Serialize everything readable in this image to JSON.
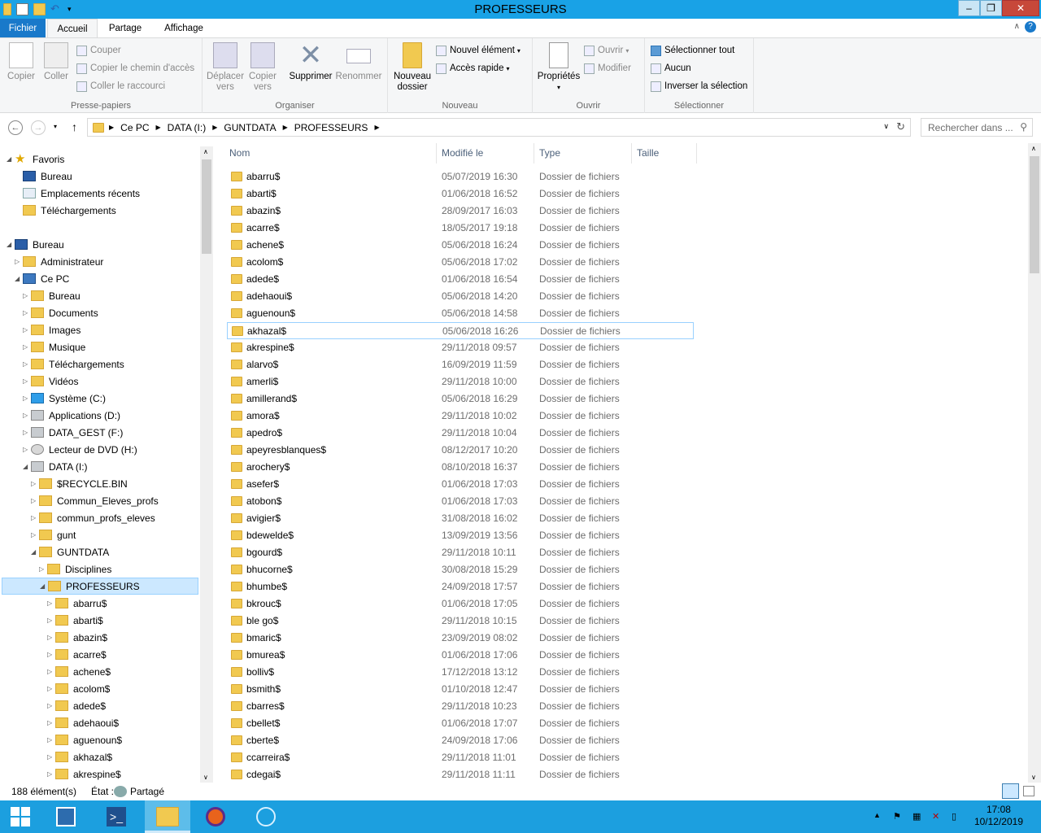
{
  "window": {
    "title": "PROFESSEURS"
  },
  "ribbon_tabs": {
    "file": "Fichier",
    "home": "Accueil",
    "share": "Partage",
    "view": "Affichage"
  },
  "ribbon": {
    "clipboard": {
      "label": "Presse-papiers",
      "copy": "Copier",
      "paste": "Coller",
      "cut": "Couper",
      "copy_path": "Copier le chemin d'accès",
      "paste_shortcut": "Coller le raccourci"
    },
    "organize": {
      "label": "Organiser",
      "move_l1": "Déplacer",
      "move_l2": "vers",
      "copyto_l1": "Copier",
      "copyto_l2": "vers",
      "delete": "Supprimer",
      "rename": "Renommer"
    },
    "new": {
      "label": "Nouveau",
      "new_folder_l1": "Nouveau",
      "new_folder_l2": "dossier",
      "new_item": "Nouvel élément",
      "easy_access": "Accès rapide"
    },
    "open": {
      "label": "Ouvrir",
      "properties": "Propriétés",
      "open": "Ouvrir",
      "edit": "Modifier"
    },
    "select": {
      "label": "Sélectionner",
      "select_all": "Sélectionner tout",
      "select_none": "Aucun",
      "invert": "Inverser la sélection"
    }
  },
  "address": {
    "crumbs": [
      "Ce PC",
      "DATA (I:)",
      "GUNTDATA",
      "PROFESSEURS"
    ],
    "search_placeholder": "Rechercher dans ..."
  },
  "tree": [
    {
      "label": "Favoris",
      "icon": "star-icon"
    },
    {
      "label": "Bureau",
      "icon": "desktop-icon"
    },
    {
      "label": "Emplacements récents",
      "icon": "recent-icon"
    },
    {
      "label": "Téléchargements",
      "icon": "downloads-icon"
    },
    {
      "label": "Bureau",
      "icon": "desktop-icon"
    },
    {
      "label": "Administrateur",
      "icon": "user-folder-icon"
    },
    {
      "label": "Ce PC",
      "icon": "computer-icon"
    },
    {
      "label": "Bureau",
      "icon": "folder-icon"
    },
    {
      "label": "Documents",
      "icon": "folder-icon"
    },
    {
      "label": "Images",
      "icon": "folder-icon"
    },
    {
      "label": "Musique",
      "icon": "folder-icon"
    },
    {
      "label": "Téléchargements",
      "icon": "folder-icon"
    },
    {
      "label": "Vidéos",
      "icon": "folder-icon"
    },
    {
      "label": "Système (C:)",
      "icon": "windows-drive-icon"
    },
    {
      "label": "Applications (D:)",
      "icon": "drive-icon"
    },
    {
      "label": "DATA_GEST (F:)",
      "icon": "drive-icon"
    },
    {
      "label": "Lecteur de DVD (H:)",
      "icon": "dvd-icon"
    },
    {
      "label": "DATA (I:)",
      "icon": "drive-icon"
    },
    {
      "label": "$RECYCLE.BIN",
      "icon": "folder-icon"
    },
    {
      "label": "Commun_Eleves_profs",
      "icon": "folder-icon"
    },
    {
      "label": "commun_profs_eleves",
      "icon": "folder-icon"
    },
    {
      "label": "gunt",
      "icon": "folder-icon"
    },
    {
      "label": "GUNTDATA",
      "icon": "folder-icon"
    },
    {
      "label": "Disciplines",
      "icon": "folder-icon"
    },
    {
      "label": "PROFESSEURS",
      "icon": "folder-icon"
    },
    {
      "label": "abarru$",
      "icon": "folder-icon"
    },
    {
      "label": "abarti$",
      "icon": "folder-icon"
    },
    {
      "label": "abazin$",
      "icon": "folder-icon"
    },
    {
      "label": "acarre$",
      "icon": "folder-icon"
    },
    {
      "label": "achene$",
      "icon": "folder-icon"
    },
    {
      "label": "acolom$",
      "icon": "folder-icon"
    },
    {
      "label": "adede$",
      "icon": "folder-icon"
    },
    {
      "label": "adehaoui$",
      "icon": "folder-icon"
    },
    {
      "label": "aguenoun$",
      "icon": "folder-icon"
    },
    {
      "label": "akhazal$",
      "icon": "folder-icon"
    },
    {
      "label": "akrespine$",
      "icon": "folder-icon"
    }
  ],
  "columns": {
    "name": "Nom",
    "modified": "Modifié le",
    "type": "Type",
    "size": "Taille"
  },
  "files": [
    {
      "name": "abarru$",
      "date": "05/07/2019 16:30",
      "type": "Dossier de fichiers"
    },
    {
      "name": "abarti$",
      "date": "01/06/2018 16:52",
      "type": "Dossier de fichiers"
    },
    {
      "name": "abazin$",
      "date": "28/09/2017 16:03",
      "type": "Dossier de fichiers"
    },
    {
      "name": "acarre$",
      "date": "18/05/2017 19:18",
      "type": "Dossier de fichiers"
    },
    {
      "name": "achene$",
      "date": "05/06/2018 16:24",
      "type": "Dossier de fichiers"
    },
    {
      "name": "acolom$",
      "date": "05/06/2018 17:02",
      "type": "Dossier de fichiers"
    },
    {
      "name": "adede$",
      "date": "01/06/2018 16:54",
      "type": "Dossier de fichiers"
    },
    {
      "name": "adehaoui$",
      "date": "05/06/2018 14:20",
      "type": "Dossier de fichiers"
    },
    {
      "name": "aguenoun$",
      "date": "05/06/2018 14:58",
      "type": "Dossier de fichiers"
    },
    {
      "name": "akhazal$",
      "date": "05/06/2018 16:26",
      "type": "Dossier de fichiers"
    },
    {
      "name": "akrespine$",
      "date": "29/11/2018 09:57",
      "type": "Dossier de fichiers"
    },
    {
      "name": "alarvo$",
      "date": "16/09/2019 11:59",
      "type": "Dossier de fichiers"
    },
    {
      "name": "amerli$",
      "date": "29/11/2018 10:00",
      "type": "Dossier de fichiers"
    },
    {
      "name": "amillerand$",
      "date": "05/06/2018 16:29",
      "type": "Dossier de fichiers"
    },
    {
      "name": "amora$",
      "date": "29/11/2018 10:02",
      "type": "Dossier de fichiers"
    },
    {
      "name": "apedro$",
      "date": "29/11/2018 10:04",
      "type": "Dossier de fichiers"
    },
    {
      "name": "apeyresblanques$",
      "date": "08/12/2017 10:20",
      "type": "Dossier de fichiers"
    },
    {
      "name": "arochery$",
      "date": "08/10/2018 16:37",
      "type": "Dossier de fichiers"
    },
    {
      "name": "asefer$",
      "date": "01/06/2018 17:03",
      "type": "Dossier de fichiers"
    },
    {
      "name": "atobon$",
      "date": "01/06/2018 17:03",
      "type": "Dossier de fichiers"
    },
    {
      "name": "avigier$",
      "date": "31/08/2018 16:02",
      "type": "Dossier de fichiers"
    },
    {
      "name": "bdewelde$",
      "date": "13/09/2019 13:56",
      "type": "Dossier de fichiers"
    },
    {
      "name": "bgourd$",
      "date": "29/11/2018 10:11",
      "type": "Dossier de fichiers"
    },
    {
      "name": "bhucorne$",
      "date": "30/08/2018 15:29",
      "type": "Dossier de fichiers"
    },
    {
      "name": "bhumbe$",
      "date": "24/09/2018 17:57",
      "type": "Dossier de fichiers"
    },
    {
      "name": "bkrouc$",
      "date": "01/06/2018 17:05",
      "type": "Dossier de fichiers"
    },
    {
      "name": "ble go$",
      "date": "29/11/2018 10:15",
      "type": "Dossier de fichiers"
    },
    {
      "name": "bmaric$",
      "date": "23/09/2019 08:02",
      "type": "Dossier de fichiers"
    },
    {
      "name": "bmurea$",
      "date": "01/06/2018 17:06",
      "type": "Dossier de fichiers"
    },
    {
      "name": "bolliv$",
      "date": "17/12/2018 13:12",
      "type": "Dossier de fichiers"
    },
    {
      "name": "bsmith$",
      "date": "01/10/2018 12:47",
      "type": "Dossier de fichiers"
    },
    {
      "name": "cbarres$",
      "date": "29/11/2018 10:23",
      "type": "Dossier de fichiers"
    },
    {
      "name": "cbellet$",
      "date": "01/06/2018 17:07",
      "type": "Dossier de fichiers"
    },
    {
      "name": "cberte$",
      "date": "24/09/2018 17:06",
      "type": "Dossier de fichiers"
    },
    {
      "name": "ccarreira$",
      "date": "29/11/2018 11:01",
      "type": "Dossier de fichiers"
    },
    {
      "name": "cdegai$",
      "date": "29/11/2018 11:11",
      "type": "Dossier de fichiers"
    }
  ],
  "selected_file": "akhazal$",
  "status": {
    "count": "188 élément(s)",
    "state_label": "État :",
    "state_value": "Partagé"
  },
  "clock": {
    "time": "17:08",
    "date": "10/12/2019"
  },
  "colors": {
    "titlebar": "#19a2e6",
    "file_tab": "#1979ca",
    "taskbar": "#1c9fdf",
    "folder": "#f1c950",
    "selection": "#99d1ff"
  }
}
